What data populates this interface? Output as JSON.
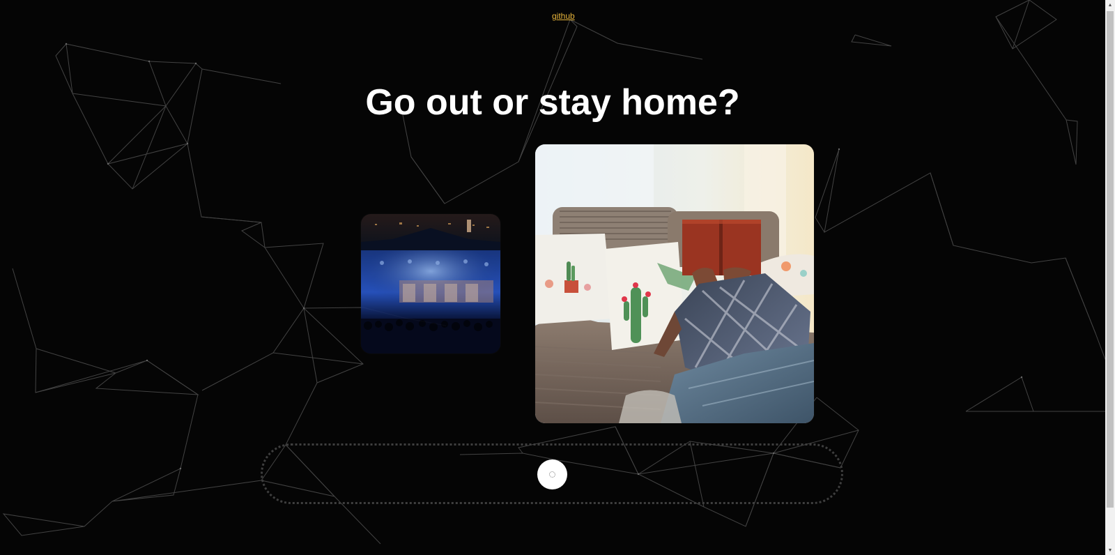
{
  "header": {
    "link_text": "github"
  },
  "main": {
    "title": "Go out or stay home?"
  },
  "images": {
    "left": "concert-scene-image",
    "right": "reading-on-couch-image"
  },
  "controls": {
    "knob_icon": "loading-circle-icon"
  },
  "colors": {
    "background": "#050505",
    "link": "#e7b43b",
    "title": "#ffffff"
  }
}
